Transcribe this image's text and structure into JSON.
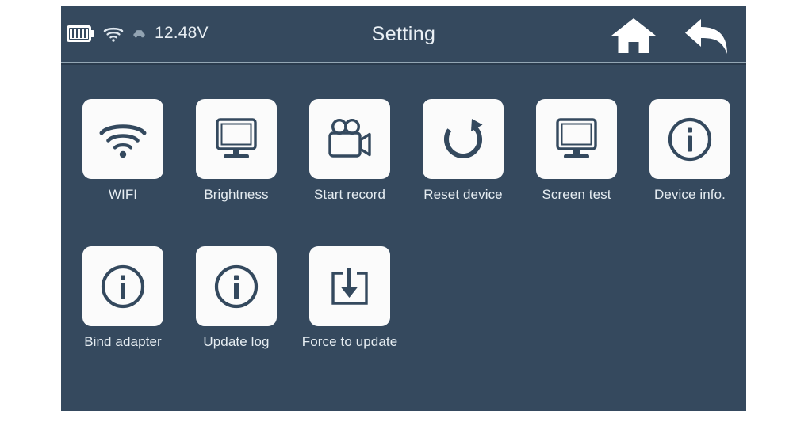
{
  "header": {
    "title": "Setting",
    "status": {
      "battery_icon": "battery-icon",
      "wifi_icon": "wifi-icon",
      "vehicle_icon": "car-icon",
      "voltage": "12.48V"
    },
    "home_label": "home-icon",
    "back_label": "back-arrow-icon"
  },
  "grid": {
    "rows": [
      [
        {
          "id": "wifi",
          "label": "WIFI",
          "icon": "wifi-icon"
        },
        {
          "id": "brightness",
          "label": "Brightness",
          "icon": "monitor-icon"
        },
        {
          "id": "start-record",
          "label": "Start record",
          "icon": "video-camera-icon"
        },
        {
          "id": "reset-device",
          "label": "Reset device",
          "icon": "refresh-icon"
        },
        {
          "id": "screen-test",
          "label": "Screen test",
          "icon": "monitor-icon"
        },
        {
          "id": "device-info",
          "label": "Device info.",
          "icon": "info-circle-icon"
        }
      ],
      [
        {
          "id": "bind-adapter",
          "label": "Bind adapter",
          "icon": "info-circle-icon"
        },
        {
          "id": "update-log",
          "label": "Update log",
          "icon": "info-circle-icon"
        },
        {
          "id": "force-to-update",
          "label": "Force to update",
          "icon": "download-box-icon"
        }
      ]
    ]
  },
  "colors": {
    "screen_background": "#35495e",
    "tile_background": "#fbfbfb",
    "icon_stroke": "#34495e",
    "text": "#e6edf2",
    "divider": "#93a6b4"
  }
}
